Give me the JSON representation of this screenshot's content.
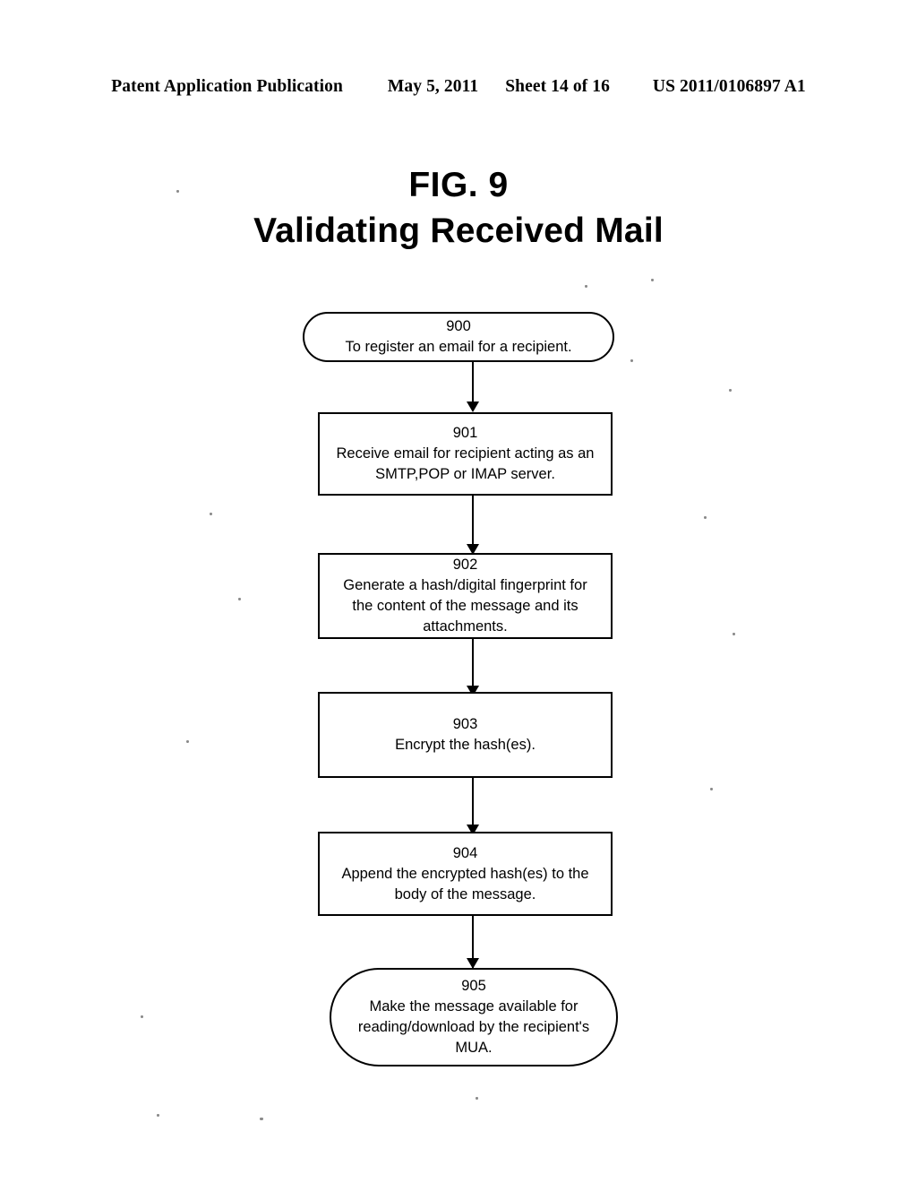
{
  "header": {
    "publication": "Patent Application Publication",
    "date": "May 5, 2011",
    "sheet": "Sheet 14 of 16",
    "pub_number": "US 2011/0106897 A1"
  },
  "figure": {
    "number": "FIG. 9",
    "caption": "Validating Received Mail"
  },
  "flowchart": {
    "nodes": [
      {
        "id": "900",
        "shape": "terminal",
        "text": "To register an email for a recipient."
      },
      {
        "id": "901",
        "shape": "process",
        "text": "Receive email for recipient acting as an\nSMTP,POP or IMAP server."
      },
      {
        "id": "902",
        "shape": "process",
        "text": "Generate a hash/digital fingerprint for\nthe content of the message and its\nattachments."
      },
      {
        "id": "903",
        "shape": "process",
        "text": "Encrypt the hash(es)."
      },
      {
        "id": "904",
        "shape": "process",
        "text": "Append the encrypted hash(es) to the\nbody of the message."
      },
      {
        "id": "905",
        "shape": "terminal",
        "text": "Make the message available for\nreading/download by the recipient's\nMUA."
      }
    ],
    "connectors": [
      {
        "from": "900",
        "to": "901"
      },
      {
        "from": "901",
        "to": "902"
      },
      {
        "from": "902",
        "to": "903"
      },
      {
        "from": "903",
        "to": "904"
      },
      {
        "from": "904",
        "to": "905"
      }
    ]
  },
  "colors": {
    "ink": "#000000",
    "paper": "#ffffff"
  }
}
